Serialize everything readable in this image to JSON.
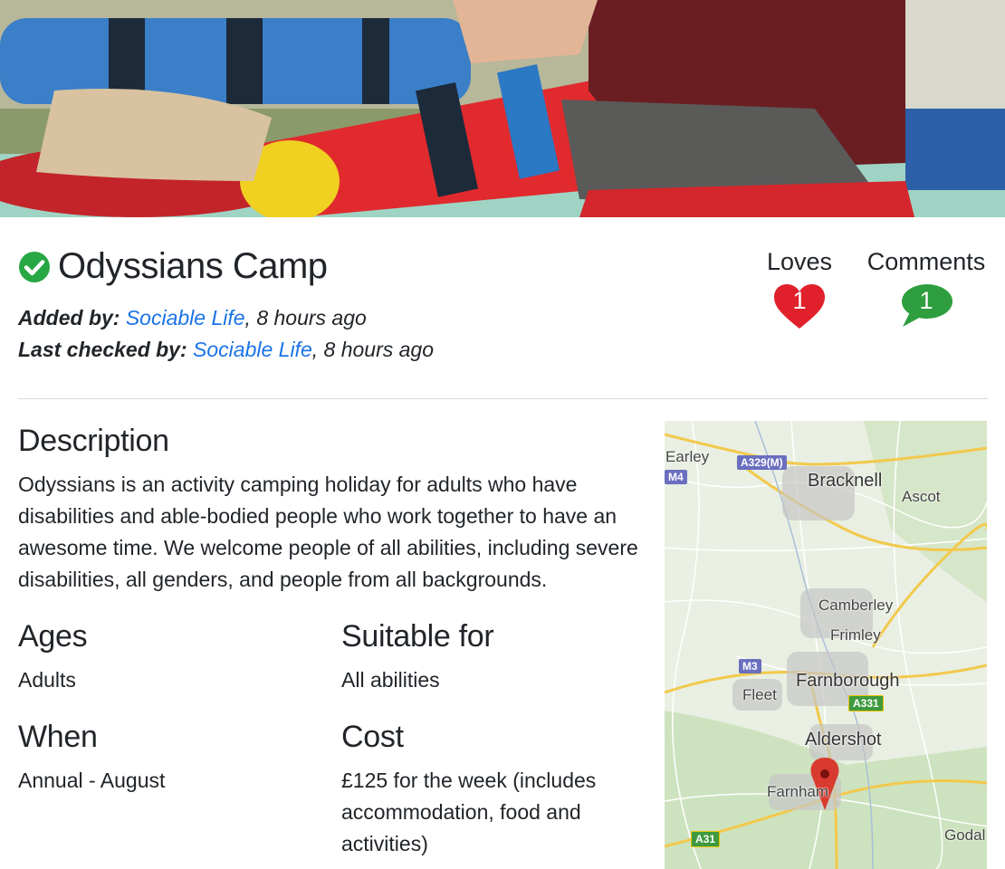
{
  "listing": {
    "title": "Odyssians Camp",
    "added_label": "Added by:",
    "added_user": "Sociable Life",
    "added_time": ", 8 hours ago",
    "checked_label": "Last checked by:",
    "checked_user": "Sociable Life",
    "checked_time": ", 8 hours ago"
  },
  "stats": {
    "loves_label": "Loves",
    "loves_count": "1",
    "comments_label": "Comments",
    "comments_count": "1"
  },
  "sections": {
    "description_heading": "Description",
    "description_text": "Odyssians is an activity camping holiday for adults who have disabilities and able-bodied people who work together to have an awesome time. We welcome people of all abilities, including severe disabilities, all genders, and people from all backgrounds.",
    "ages_heading": "Ages",
    "ages_value": "Adults",
    "suitable_heading": "Suitable for",
    "suitable_value": "All abilities",
    "when_heading": "When",
    "when_value": "Annual - August",
    "cost_heading": "Cost",
    "cost_value": "£125 for the week (includes accommodation, food and activities)"
  },
  "map": {
    "places": [
      "Earley",
      "Bracknell",
      "Ascot",
      "Camberley",
      "Frimley",
      "Farnborough",
      "Fleet",
      "Aldershot",
      "Farnham",
      "Godal"
    ],
    "roads": [
      "A329(M)",
      "M4",
      "M3",
      "A331",
      "A31"
    ]
  },
  "colors": {
    "link": "#1a73e8",
    "verified": "#28a745",
    "love": "#e0212b",
    "comment": "#2e9e3e"
  }
}
